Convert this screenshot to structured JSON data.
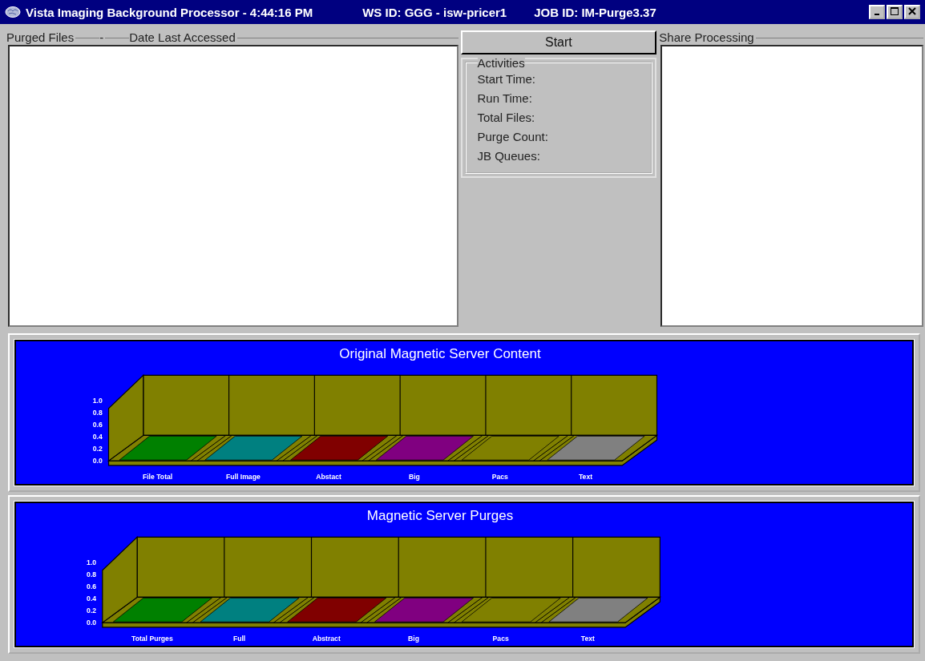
{
  "window": {
    "title": "Vista Imaging Background Processor - 4:44:16 PM",
    "ws_id": "WS ID: GGG - isw-pricer1",
    "job_id": "JOB ID: IM-Purge3.37"
  },
  "purged_files": {
    "columns": [
      "Purged Files",
      "-",
      "Date Last Accessed"
    ]
  },
  "start_button": {
    "label": "Start"
  },
  "activities": {
    "title": "Activities",
    "fields": [
      "Start Time:",
      "Run Time:",
      "Total Files:",
      "Purge Count:",
      "JB Queues:"
    ]
  },
  "share_processing": {
    "title": "Share Processing"
  },
  "charts": [
    {
      "title": "Original Magnetic Server Content",
      "yticks": [
        "1.0",
        "0.8",
        "0.6",
        "0.4",
        "0.2",
        "0.0"
      ],
      "categories": [
        {
          "label": "File Total",
          "color": "#008000"
        },
        {
          "label": "Full Image",
          "color": "#008080"
        },
        {
          "label": "Abstact",
          "color": "#800000"
        },
        {
          "label": "Big",
          "color": "#800080"
        },
        {
          "label": "Pacs",
          "color": "#808000"
        },
        {
          "label": "Text",
          "color": "#808080"
        }
      ]
    },
    {
      "title": "Magnetic Server Purges",
      "yticks": [
        "1.0",
        "0.8",
        "0.6",
        "0.4",
        "0.2",
        "0.0"
      ],
      "categories": [
        {
          "label": "Total Purges",
          "color": "#008000"
        },
        {
          "label": "Full",
          "color": "#008080"
        },
        {
          "label": "Abstract",
          "color": "#800000"
        },
        {
          "label": "Big",
          "color": "#800080"
        },
        {
          "label": "Pacs",
          "color": "#808000"
        },
        {
          "label": "Text",
          "color": "#808080"
        }
      ]
    }
  ]
}
